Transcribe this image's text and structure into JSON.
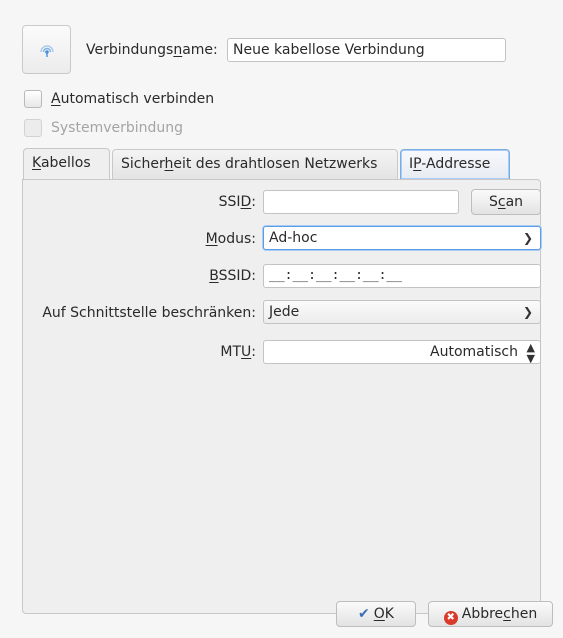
{
  "connection": {
    "icon": "wireless-icon",
    "name_label": "Verbindungsname:",
    "name_value": "Neue kabellose Verbindung"
  },
  "options": {
    "auto_connect": "Automatisch verbinden",
    "system_connection": "Systemverbindung"
  },
  "tabs": [
    {
      "label": "Kabellos"
    },
    {
      "label": "Sicherheit des drahtlosen Netzwerks"
    },
    {
      "label": "IP-Addresse"
    }
  ],
  "form": {
    "ssid_label": "SSID:",
    "ssid_value": "",
    "scan_button": "Scan",
    "mode_label": "Modus:",
    "mode_value": "Ad-hoc",
    "bssid_label": "BSSID:",
    "bssid_value": "__:__:__:__:__:__",
    "restrict_label": "Auf Schnittstelle beschränken:",
    "restrict_value": "Jede",
    "mtu_label": "MTU:",
    "mtu_value": "Automatisch"
  },
  "buttons": {
    "ok": "OK",
    "cancel": "Abbrechen"
  },
  "colors": {
    "focus_blue": "#5d9ce4",
    "cancel_red": "#d93a2b",
    "ok_check_blue": "#3d6fb6"
  }
}
